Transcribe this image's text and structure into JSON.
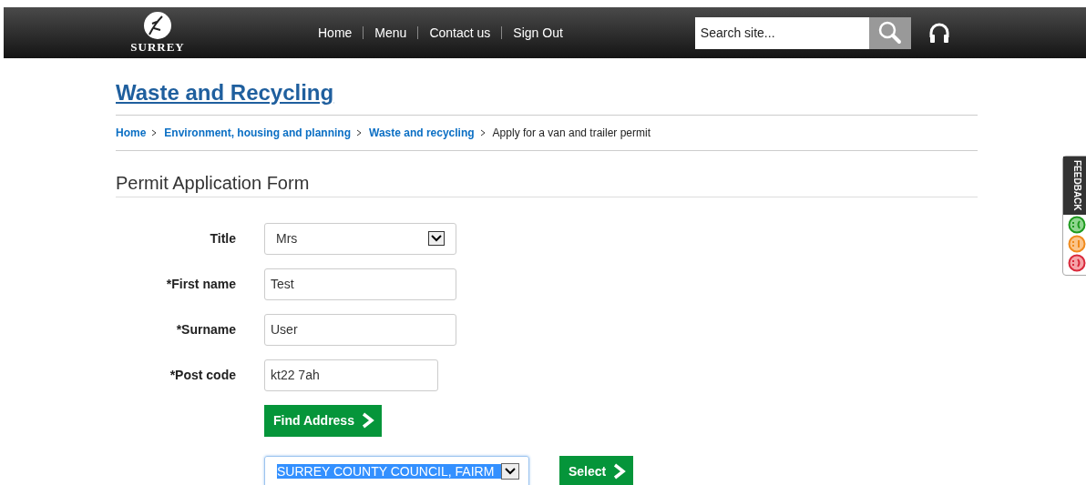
{
  "header": {
    "logo_text": "SURREY",
    "nav": [
      {
        "label": "Home"
      },
      {
        "label": "Menu"
      },
      {
        "label": "Contact us"
      },
      {
        "label": "Sign Out"
      }
    ],
    "search": {
      "placeholder": "Search site..."
    }
  },
  "page_title": "Waste and Recycling",
  "breadcrumb": [
    {
      "label": "Home",
      "kind": "link"
    },
    {
      "label": "Environment, housing and planning",
      "kind": "link"
    },
    {
      "label": "Waste and recycling",
      "kind": "link"
    },
    {
      "label": "Apply for a van and trailer permit",
      "kind": "current"
    }
  ],
  "form": {
    "title": "Permit Application Form",
    "fields": [
      {
        "label": "Title",
        "kind": "select",
        "value": "Mrs"
      },
      {
        "label": "*First name",
        "kind": "text",
        "value": "Test"
      },
      {
        "label": "*Surname",
        "kind": "text",
        "value": "User"
      },
      {
        "label": "*Post code",
        "kind": "short",
        "value": "kt22 7ah"
      }
    ],
    "find_button": "Find Address",
    "address_select": {
      "value": "SURREY COUNTY COUNCIL, FAIRM",
      "selected": true
    },
    "select_button": "Select"
  },
  "feedback": {
    "label": "FEEDBACK"
  }
}
